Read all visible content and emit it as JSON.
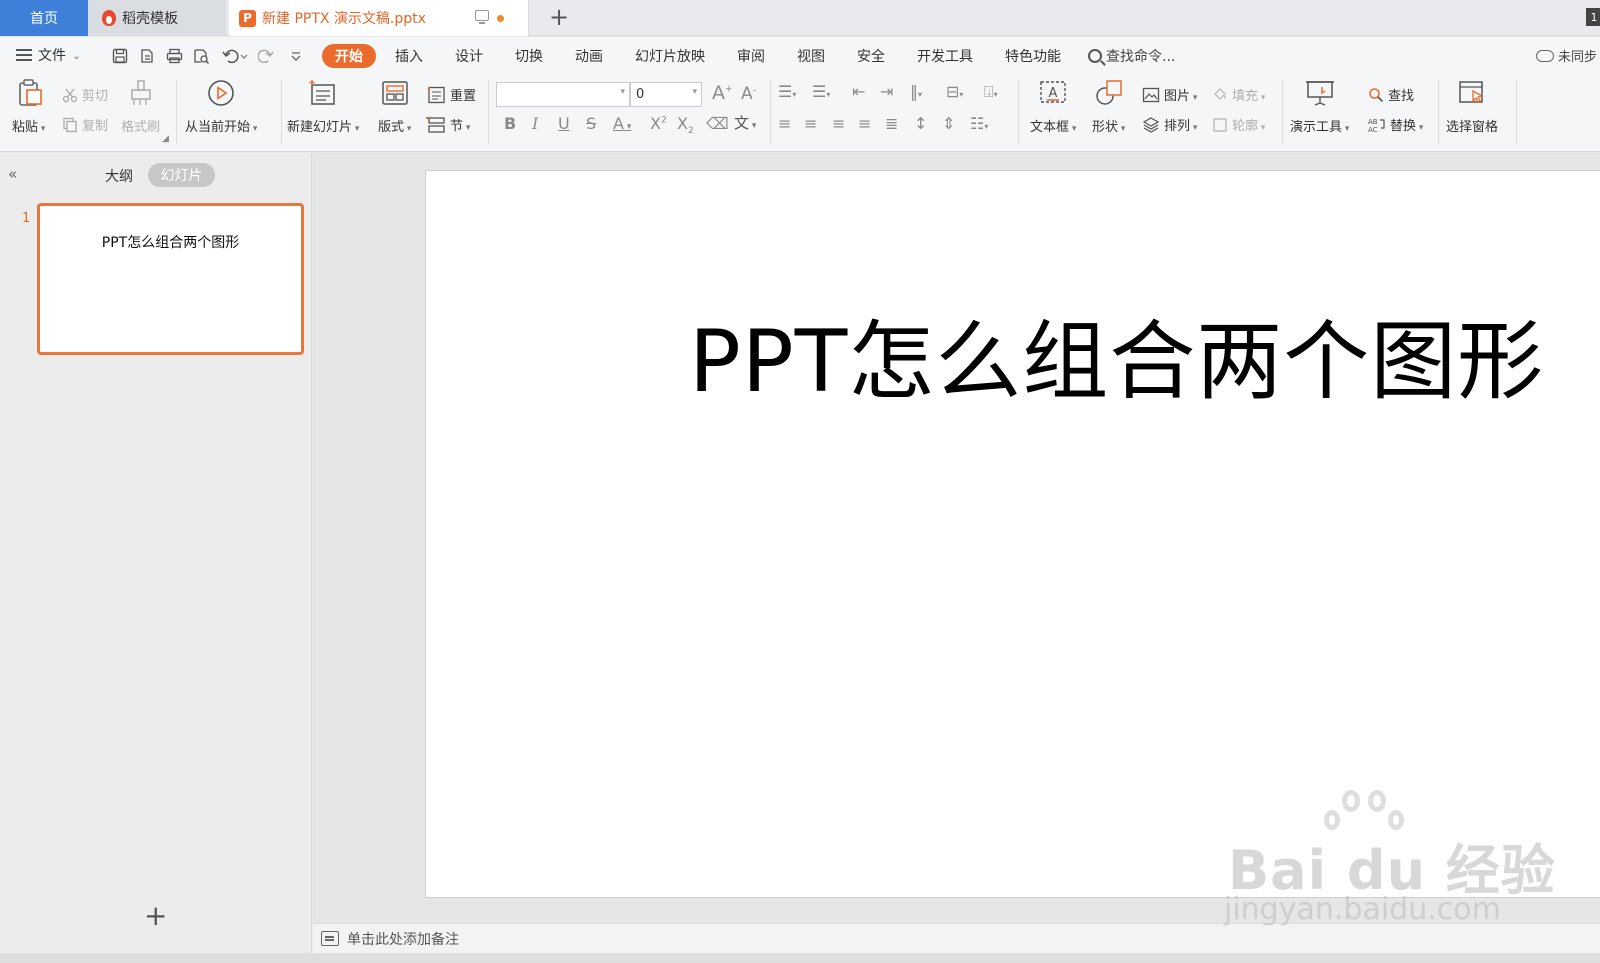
{
  "tabs": {
    "home": "首页",
    "template": "稻壳模板",
    "document": "新建 PPTX 演示文稿.pptx",
    "add": "+",
    "window_count": "1"
  },
  "menu": {
    "file": "文件",
    "items": [
      "开始",
      "插入",
      "设计",
      "切换",
      "动画",
      "幻灯片放映",
      "审阅",
      "视图",
      "安全",
      "开发工具",
      "特色功能"
    ],
    "active_index": 0,
    "search": "查找命令...",
    "sync": "未同步"
  },
  "ribbon": {
    "paste": "粘贴",
    "cut": "剪切",
    "copy": "复制",
    "format_painter": "格式刷",
    "from_current": "从当前开始",
    "new_slide": "新建幻灯片",
    "layout": "版式",
    "reset": "重置",
    "section": "节",
    "font_name": "",
    "font_size": "0",
    "text_box": "文本框",
    "shape": "形状",
    "picture": "图片",
    "arrange": "排列",
    "fill": "填充",
    "outline": "轮廓",
    "presentation_tools": "演示工具",
    "find": "查找",
    "replace": "替换",
    "selection_pane": "选择窗格"
  },
  "panel": {
    "outline_tab": "大纲",
    "slides_tab": "幻灯片",
    "slide_number": "1",
    "thumb_title": "PPT怎么组合两个图形"
  },
  "slide": {
    "title": "PPT怎么组合两个图形"
  },
  "notes": {
    "placeholder": "单击此处添加备注"
  },
  "watermark": {
    "logo": "Bai du 经验",
    "url": "jingyan.baidu.com"
  },
  "colors": {
    "accent": "#ea6b2b",
    "home_tab": "#3d7fd9",
    "selection_border": "#e8773d"
  }
}
